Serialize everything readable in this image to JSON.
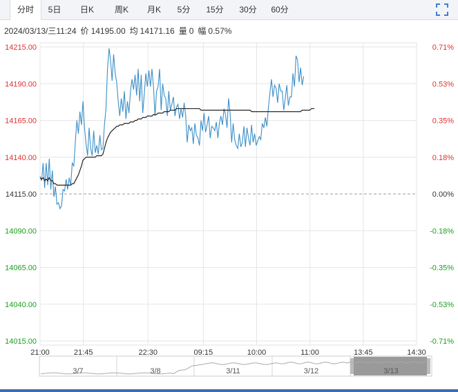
{
  "tabs": [
    {
      "label": "分时",
      "active": true
    },
    {
      "label": "5日",
      "active": false
    },
    {
      "label": "日K",
      "active": false
    },
    {
      "label": "周K",
      "active": false
    },
    {
      "label": "月K",
      "active": false
    },
    {
      "label": "5分",
      "active": false
    },
    {
      "label": "15分",
      "active": false
    },
    {
      "label": "30分",
      "active": false
    },
    {
      "label": "60分",
      "active": false
    }
  ],
  "expand_icon": "fullscreen-expand-icon",
  "info": {
    "datetime": "2024/03/13/三11:24",
    "price_label": "价",
    "price": "14195.00",
    "avg_label": "均",
    "avg": "14171.16",
    "volume_label": "量",
    "volume": "0",
    "change_label": "幅",
    "change": "0.57%"
  },
  "colors": {
    "price_line": "#3b8fc7",
    "avg_line": "#222222",
    "up": "#e03030",
    "down": "#1aa01a",
    "neutral": "#333333",
    "grid": "#e6e6e6"
  },
  "chart_data": {
    "type": "line",
    "y_ticks": [
      "14215.00",
      "14190.00",
      "14165.00",
      "14140.00",
      "14115.00",
      "14090.00",
      "14065.00",
      "14040.00",
      "14015.00"
    ],
    "pct_ticks": [
      "0.71%",
      "0.53%",
      "0.35%",
      "0.18%",
      "0.00%",
      "-0.18%",
      "-0.35%",
      "-0.53%",
      "-0.71%"
    ],
    "ylim": [
      14015,
      14215
    ],
    "base_price": 14115,
    "x_ticks": [
      "21:00",
      "21:45",
      "22:30",
      "09:15",
      "10:00",
      "11:00",
      "13:45",
      "14:30"
    ],
    "xlim": [
      0,
      565
    ],
    "x_tick_minutes": [
      0,
      65,
      162,
      245,
      325,
      405,
      485,
      565
    ],
    "price_series": [
      14127,
      14124,
      14136,
      14119,
      14136,
      14121,
      14139,
      14118,
      14131,
      14113,
      14120,
      14108,
      14109,
      14105,
      14107,
      14118,
      14117,
      14125,
      14118,
      14126,
      14121,
      14136,
      14134,
      14150,
      14165,
      14156,
      14171,
      14162,
      14178,
      14160,
      14149,
      14141,
      14160,
      14146,
      14141,
      14158,
      14143,
      14148,
      14142,
      14155,
      14145,
      14146,
      14162,
      14173,
      14200,
      14214,
      14206,
      14192,
      14210,
      14197,
      14191,
      14178,
      14168,
      14180,
      14171,
      14185,
      14166,
      14178,
      14170,
      14185,
      14193,
      14186,
      14196,
      14182,
      14200,
      14178,
      14196,
      14170,
      14183,
      14197,
      14188,
      14199,
      14188,
      14200,
      14188,
      14168,
      14185,
      14188,
      14200,
      14172,
      14190,
      14182,
      14180,
      14168,
      14185,
      14172,
      14176,
      14181,
      14168,
      14174,
      14176,
      14166,
      14173,
      14167,
      14177,
      14168,
      14150,
      14162,
      14158,
      14160,
      14149,
      14163,
      14155,
      14153,
      14148,
      14165,
      14158,
      14170,
      14157,
      14162,
      14168,
      14153,
      14161,
      14160,
      14158,
      14164,
      14153,
      14163,
      14168,
      14162,
      14173,
      14169,
      14160,
      14180,
      14170,
      14150,
      14163,
      14152,
      14148,
      14146,
      14156,
      14147,
      14150,
      14161,
      14147,
      14160,
      14153,
      14148,
      14162,
      14150,
      14156,
      14148,
      14151,
      14154,
      14152,
      14163,
      14160,
      14167,
      14161,
      14174,
      14184,
      14193,
      14181,
      14189,
      14187,
      14177,
      14190,
      14185,
      14185,
      14172,
      14180,
      14189,
      14175,
      14181,
      14181,
      14197,
      14188,
      14209,
      14206,
      14191,
      14201,
      14189,
      14195
    ],
    "price_minutes": [
      0,
      1,
      2,
      3,
      4,
      5,
      6,
      7,
      8,
      9,
      10,
      11,
      12,
      13,
      14,
      15,
      16,
      17,
      18,
      19,
      20,
      21,
      22,
      23,
      24,
      25,
      26,
      27,
      28,
      29,
      30,
      31,
      32,
      33,
      34,
      35,
      36,
      37,
      38,
      39,
      40,
      41,
      42,
      43,
      44,
      45,
      46,
      47,
      48,
      49,
      50,
      51,
      52,
      53,
      54,
      55,
      56,
      57,
      58,
      59,
      60,
      61,
      62,
      63,
      64,
      65,
      66,
      67,
      68,
      69,
      70,
      71,
      72,
      73,
      74,
      75,
      76,
      77,
      78,
      79,
      80,
      81,
      82,
      83,
      84,
      85,
      86,
      87,
      88,
      89,
      90,
      91,
      92,
      93,
      94,
      95,
      96,
      97,
      98,
      99,
      100,
      101,
      102,
      103,
      104,
      105,
      106,
      107,
      108,
      109,
      110,
      111,
      112,
      113,
      114,
      115,
      116,
      117,
      118,
      119,
      120,
      121,
      122,
      123,
      124,
      125,
      126,
      127,
      128,
      129,
      130,
      131,
      132,
      133,
      134,
      135,
      136,
      137,
      138,
      139,
      140,
      141,
      142,
      143,
      144,
      145,
      146,
      147,
      148,
      149,
      150,
      151,
      152,
      153,
      154,
      155,
      156,
      157,
      158,
      159,
      160,
      161,
      162,
      163,
      164,
      165,
      166,
      167,
      168,
      169,
      170,
      171,
      172,
      173,
      174,
      175,
      176,
      177,
      178,
      179
    ],
    "avg_series": [
      14126,
      14125,
      14126,
      14124,
      14125,
      14124,
      14126,
      14124,
      14124,
      14122,
      14122,
      14121,
      14121,
      14121,
      14121,
      14121,
      14121,
      14121,
      14121,
      14121,
      14121,
      14122,
      14122,
      14124,
      14126,
      14128,
      14131,
      14134,
      14138,
      14139,
      14140,
      14140,
      14140,
      14140,
      14140,
      14140,
      14140,
      14141,
      14141,
      14141,
      14141,
      14142,
      14146,
      14150,
      14153,
      14155,
      14157,
      14158,
      14159,
      14160,
      14161,
      14161,
      14162,
      14162,
      14162,
      14163,
      14163,
      14163,
      14163,
      14164,
      14164,
      14164,
      14165,
      14165,
      14166,
      14166,
      14166,
      14167,
      14167,
      14167,
      14168,
      14168,
      14168,
      14168,
      14169,
      14169,
      14169,
      14170,
      14170,
      14170,
      14170,
      14171,
      14171,
      14171,
      14171,
      14172,
      14172,
      14172,
      14172,
      14173,
      14173,
      14173,
      14173,
      14173,
      14173,
      14173,
      14173,
      14173,
      14173,
      14173,
      14173,
      14173,
      14173,
      14173,
      14173,
      14172,
      14172,
      14172,
      14172,
      14172,
      14172,
      14172,
      14172,
      14172,
      14172,
      14172,
      14172,
      14172,
      14172,
      14172,
      14172,
      14172,
      14172,
      14172,
      14172,
      14172,
      14172,
      14172,
      14172,
      14172,
      14172,
      14172,
      14172,
      14172,
      14172,
      14172,
      14172,
      14172,
      14171,
      14171,
      14171,
      14171,
      14171,
      14171,
      14171,
      14171,
      14171,
      14171,
      14171,
      14171,
      14171,
      14171,
      14171,
      14171,
      14171,
      14171,
      14171,
      14171,
      14171,
      14171,
      14171,
      14171,
      14171,
      14171,
      14171,
      14171,
      14171,
      14171,
      14171,
      14171,
      14171,
      14172,
      14172,
      14172,
      14172,
      14172,
      14172,
      14173,
      14173,
      14173
    ],
    "navigator": {
      "labels": [
        "3/7",
        "3/8",
        "3/11",
        "3/12",
        "3/13"
      ],
      "selected": "3/13"
    },
    "grid": true
  }
}
